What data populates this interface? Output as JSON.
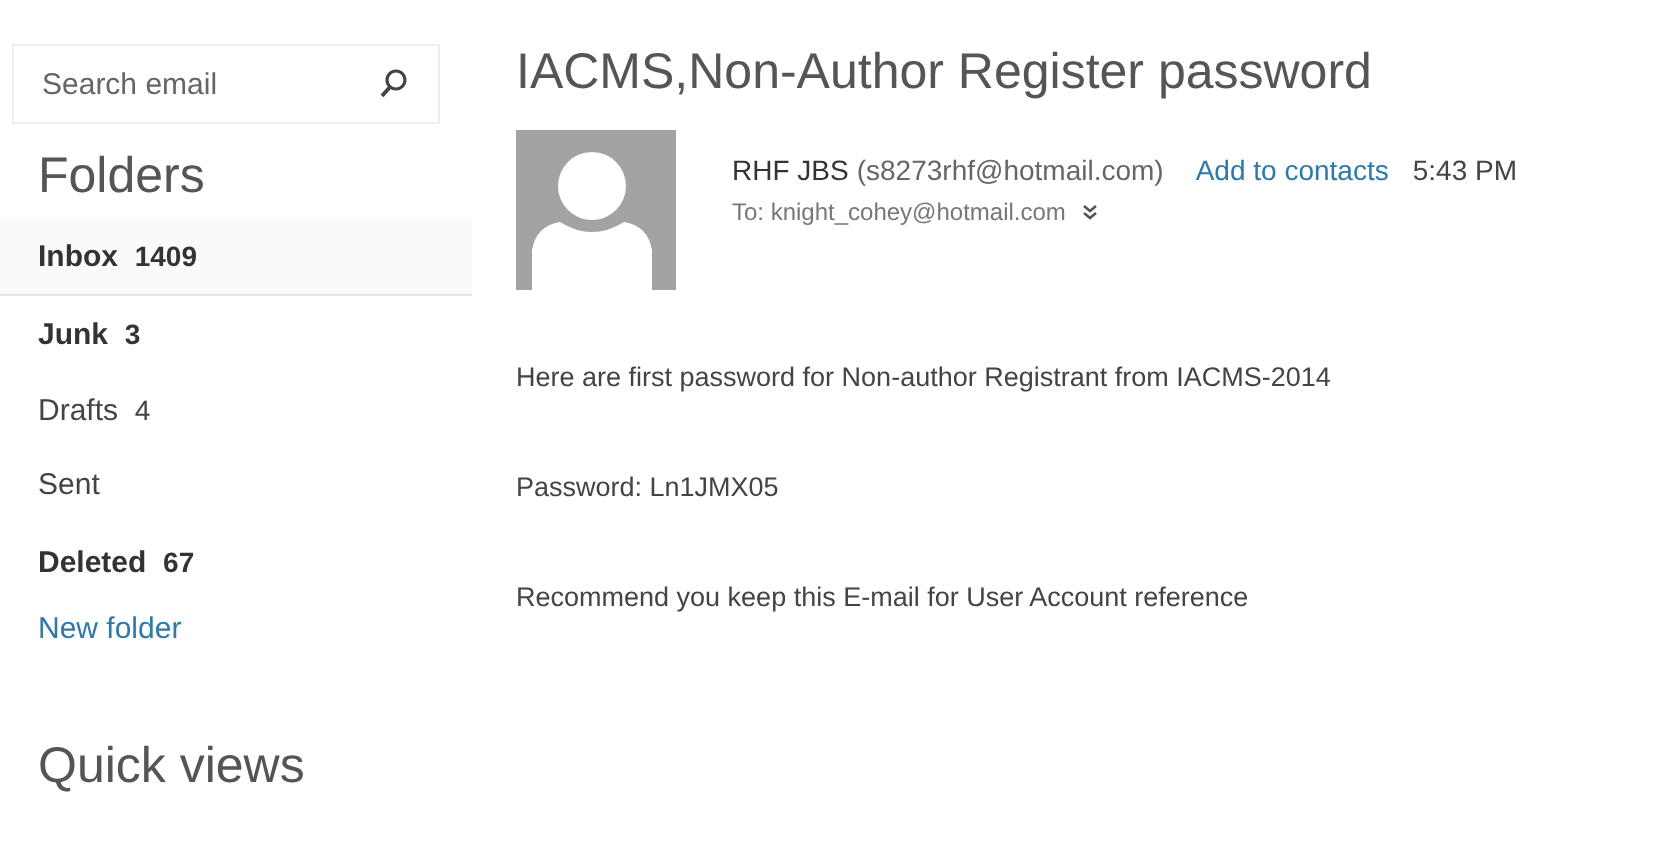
{
  "search": {
    "placeholder": "Search email"
  },
  "folders_heading": "Folders",
  "folders": [
    {
      "name": "Inbox",
      "count": "1409",
      "unread": true,
      "selected": true
    },
    {
      "name": "Junk",
      "count": "3",
      "unread": true,
      "selected": false
    },
    {
      "name": "Drafts",
      "count": "4",
      "unread": false,
      "selected": false
    },
    {
      "name": "Sent",
      "unread": false,
      "selected": false
    },
    {
      "name": "Deleted",
      "count": "67",
      "unread": true,
      "selected": false
    }
  ],
  "new_folder": "New folder",
  "quick_views_heading": "Quick views",
  "message": {
    "subject": "IACMS,Non-Author Register password",
    "sender_name": "RHF JBS",
    "sender_email": "(s8273rhf@hotmail.com)",
    "add_contact": "Add to contacts",
    "time": "5:43 PM",
    "to": "To: knight_cohey@hotmail.com",
    "body": [
      "Here are first password for Non-author Registrant from IACMS-2014",
      "Password: Ln1JMX05",
      "Recommend you keep this E-mail for User Account reference"
    ]
  }
}
